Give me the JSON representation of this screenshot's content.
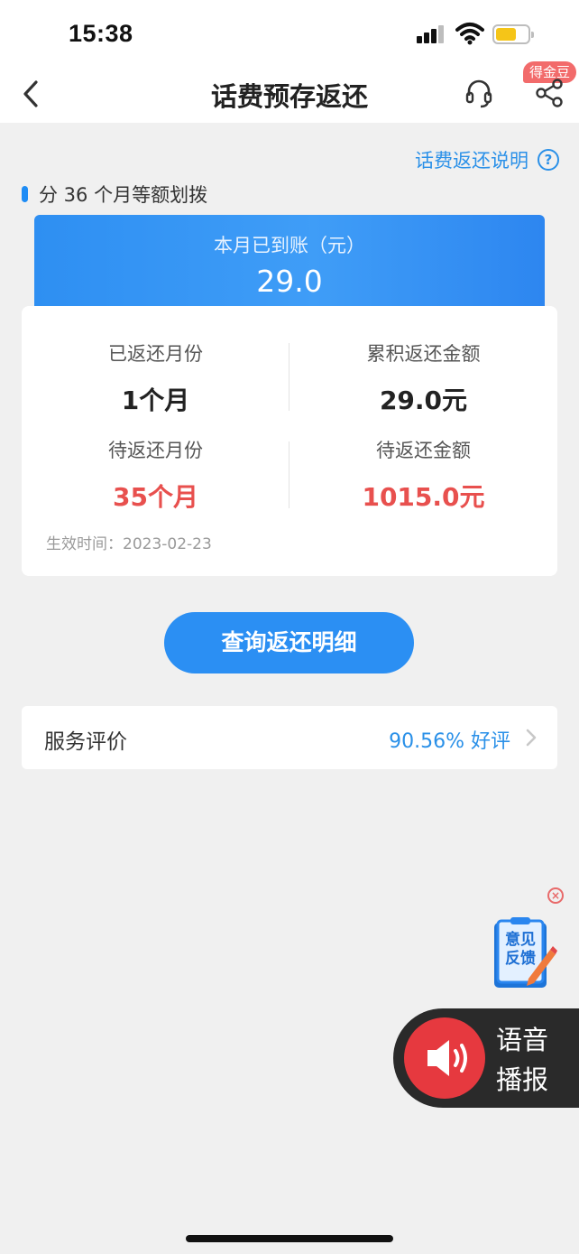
{
  "status_bar": {
    "time": "15:38"
  },
  "nav": {
    "title": "话费预存返还",
    "coin_badge": "得金豆"
  },
  "explain_link": {
    "label": "话费返还说明",
    "help_glyph": "?"
  },
  "section": {
    "title": "分 36 个月等额划拨"
  },
  "banner": {
    "label": "本月已到账（元）",
    "value": "29.0"
  },
  "stats": {
    "returned_months_label": "已返还月份",
    "returned_months_value": "1个月",
    "accumulated_label": "累积返还金额",
    "accumulated_value": "29.0元",
    "pending_months_label": "待返还月份",
    "pending_months_value": "35个月",
    "pending_amount_label": "待返还金额",
    "pending_amount_value": "1015.0元",
    "effective_time": "生效时间：2023-02-23"
  },
  "query_button": {
    "label": "查询返还明细"
  },
  "rating": {
    "label": "服务评价",
    "value": "90.56% 好评"
  },
  "feedback": {
    "line1": "意见",
    "line2": "反馈"
  },
  "voice": {
    "line1": "语音",
    "line2": "播报"
  },
  "colors": {
    "accent": "#2b8ff3",
    "highlight_red": "#e8504e",
    "background": "#f0f0f0"
  }
}
